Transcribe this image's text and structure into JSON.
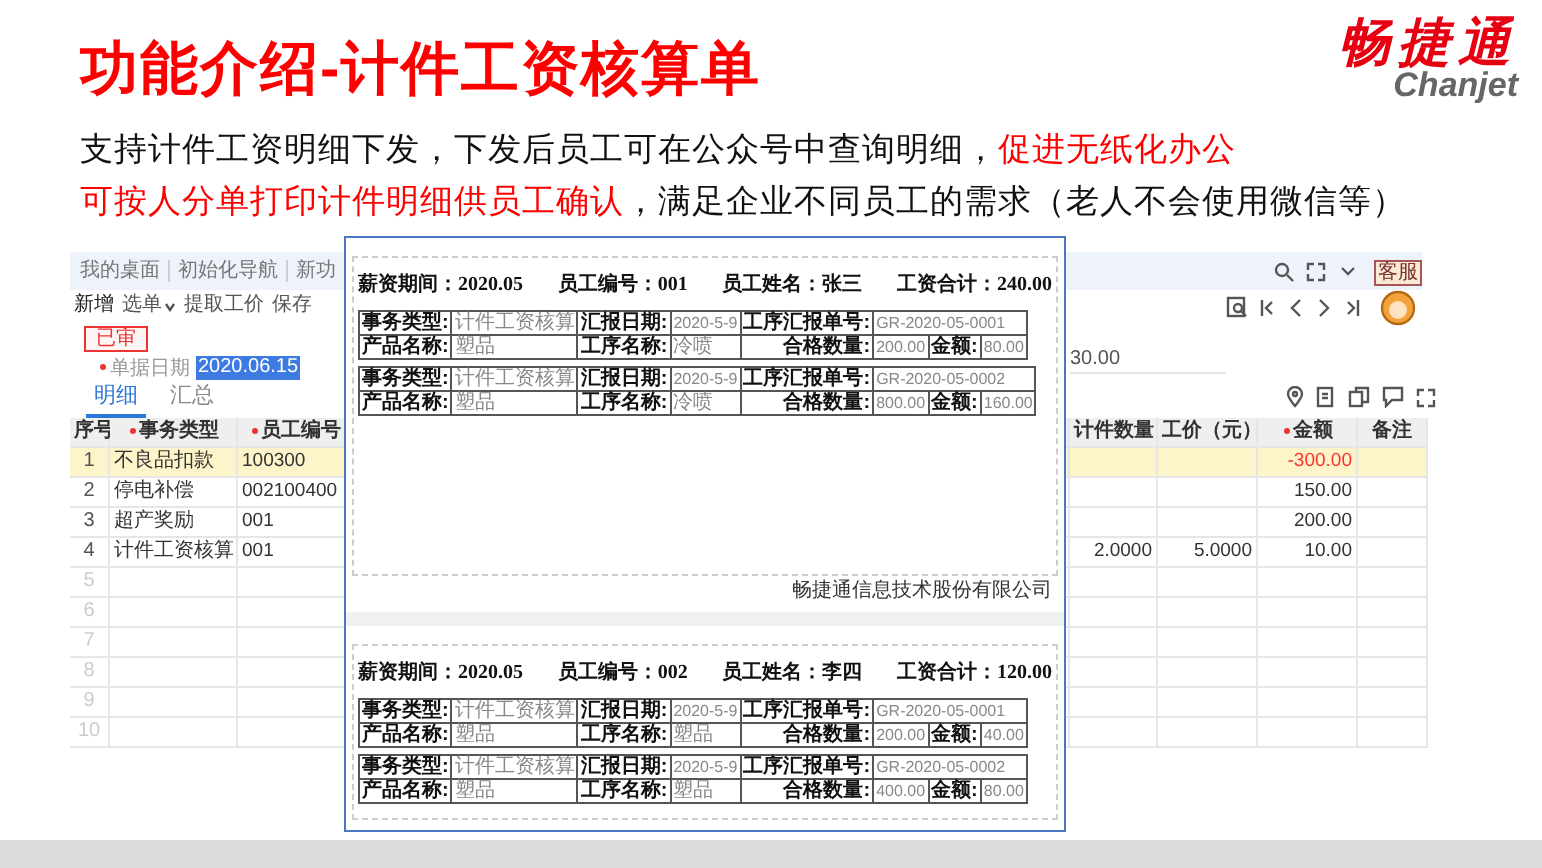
{
  "slide": {
    "title": "功能介绍-计件工资核算单",
    "logo": {
      "name": "畅捷通",
      "latin": "Chanjet"
    },
    "paragraphs": [
      [
        {
          "text": "支持计件工资明细下发，下发后员工可在公众号中查询明细，",
          "highlight": false
        },
        {
          "text": "促进无纸化办公",
          "highlight": true
        }
      ],
      [
        {
          "text": "可按人分单打印计件明细供员工确认",
          "highlight": true
        },
        {
          "text": "，满足企业不同员工的需求（老人不会使用微信等）",
          "highlight": false
        }
      ]
    ]
  },
  "app": {
    "nav_tabs": [
      "我的桌面",
      "初始化导航",
      "新功"
    ],
    "toolbar": [
      {
        "label": "新增",
        "dropdown": false
      },
      {
        "label": "选单",
        "dropdown": true
      },
      {
        "label": "提取工价",
        "dropdown": false
      },
      {
        "label": "保存",
        "dropdown": false
      }
    ],
    "support_badge": "客服",
    "status": "已审",
    "date_field": {
      "label": "单据日期",
      "required": true,
      "value": "2020.06.15",
      "selected": true
    },
    "total_fragment": "30.00",
    "tabs": [
      {
        "label": "明细",
        "selected": true
      },
      {
        "label": "汇总",
        "selected": false
      }
    ],
    "table": {
      "columns": [
        {
          "label": "序号",
          "required": false
        },
        {
          "label": "事务类型",
          "required": true
        },
        {
          "label": "员工编号",
          "required": true
        },
        {
          "label": "计件数量",
          "required": false
        },
        {
          "label": "工价（元）",
          "required": false
        },
        {
          "label": "金额",
          "required": true
        },
        {
          "label": "备注",
          "required": false
        }
      ],
      "rows": [
        {
          "cells": [
            "1",
            "不良品扣款",
            "100300",
            "",
            "",
            "-300.00",
            ""
          ],
          "selected": true,
          "negative": true
        },
        {
          "cells": [
            "2",
            "停电补偿",
            "002100400",
            "",
            "",
            "150.00",
            ""
          ],
          "selected": false,
          "negative": false
        },
        {
          "cells": [
            "3",
            "超产奖励",
            "001",
            "",
            "",
            "200.00",
            ""
          ],
          "selected": false,
          "negative": false
        },
        {
          "cells": [
            "4",
            "计件工资核算",
            "001",
            "2.0000",
            "5.0000",
            "10.00",
            ""
          ],
          "selected": false,
          "negative": false
        },
        {
          "cells": [
            "5",
            "",
            "",
            "",
            "",
            "",
            ""
          ],
          "selected": false,
          "negative": false
        },
        {
          "cells": [
            "6",
            "",
            "",
            "",
            "",
            "",
            ""
          ],
          "selected": false,
          "negative": false
        },
        {
          "cells": [
            "7",
            "",
            "",
            "",
            "",
            "",
            ""
          ],
          "selected": false,
          "negative": false
        },
        {
          "cells": [
            "8",
            "",
            "",
            "",
            "",
            "",
            ""
          ],
          "selected": false,
          "negative": false
        },
        {
          "cells": [
            "9",
            "",
            "",
            "",
            "",
            "",
            ""
          ],
          "selected": false,
          "negative": false
        },
        {
          "cells": [
            "10",
            "",
            "",
            "",
            "",
            "",
            ""
          ],
          "selected": false,
          "negative": false
        }
      ]
    }
  },
  "print_preview": {
    "pages": [
      {
        "header": [
          "薪资期间：2020.05",
          "员工编号：001",
          "员工姓名：张三",
          "工资合计：240.00"
        ],
        "slips": [
          {
            "fields": [
              {
                "label": "事务类型:",
                "value": "计件工资核算"
              },
              {
                "label": "汇报日期:",
                "value": "2020-5-9"
              },
              {
                "label": "工序汇报单号:",
                "value": "GR-2020-05-0001"
              },
              {
                "label": "产品名称:",
                "value": "塑品"
              },
              {
                "label": "工序名称:",
                "value": "冷喷"
              },
              {
                "label": "合格数量:",
                "value": "200.00"
              },
              {
                "label": "金额:",
                "value": "80.00"
              }
            ]
          },
          {
            "fields": [
              {
                "label": "事务类型:",
                "value": "计件工资核算"
              },
              {
                "label": "汇报日期:",
                "value": "2020-5-9"
              },
              {
                "label": "工序汇报单号:",
                "value": "GR-2020-05-0002"
              },
              {
                "label": "产品名称:",
                "value": "塑品"
              },
              {
                "label": "工序名称:",
                "value": "冷喷"
              },
              {
                "label": "合格数量:",
                "value": "800.00"
              },
              {
                "label": "金额:",
                "value": "160.00"
              }
            ]
          }
        ],
        "footer": "畅捷通信息技术股份有限公司"
      },
      {
        "header": [
          "薪资期间：2020.05",
          "员工编号：002",
          "员工姓名：李四",
          "工资合计：120.00"
        ],
        "slips": [
          {
            "fields": [
              {
                "label": "事务类型:",
                "value": "计件工资核算"
              },
              {
                "label": "汇报日期:",
                "value": "2020-5-9"
              },
              {
                "label": "工序汇报单号:",
                "value": "GR-2020-05-0001"
              },
              {
                "label": "产品名称:",
                "value": "塑品"
              },
              {
                "label": "工序名称:",
                "value": "塑品"
              },
              {
                "label": "合格数量:",
                "value": "200.00"
              },
              {
                "label": "金额:",
                "value": "40.00"
              }
            ]
          },
          {
            "fields": [
              {
                "label": "事务类型:",
                "value": "计件工资核算"
              },
              {
                "label": "汇报日期:",
                "value": "2020-5-9"
              },
              {
                "label": "工序汇报单号:",
                "value": "GR-2020-05-0002"
              },
              {
                "label": "产品名称:",
                "value": "塑品"
              },
              {
                "label": "工序名称:",
                "value": "塑品"
              },
              {
                "label": "合格数量:",
                "value": "400.00"
              },
              {
                "label": "金额:",
                "value": "80.00"
              }
            ]
          }
        ]
      }
    ]
  }
}
